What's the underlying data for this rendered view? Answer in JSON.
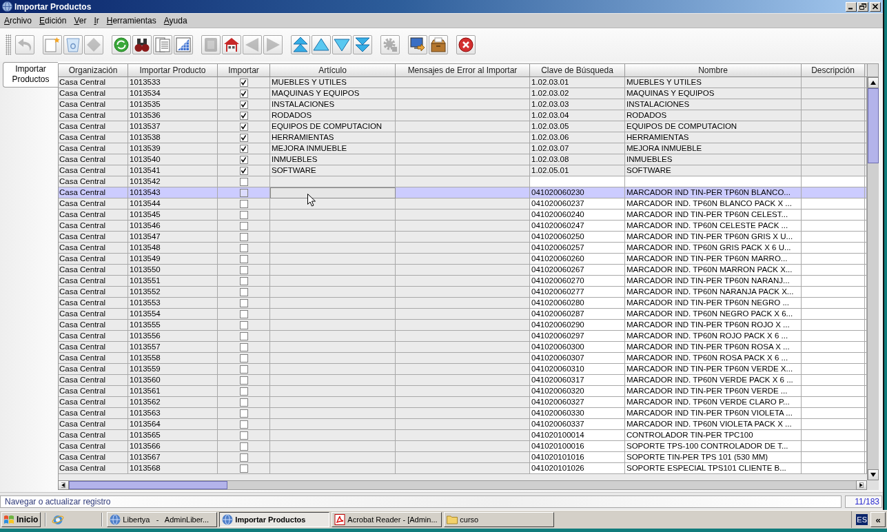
{
  "window": {
    "title": "Importar Productos"
  },
  "menu": [
    "Archivo",
    "Edición",
    "Ver",
    "Ir",
    "Herramientas",
    "Ayuda"
  ],
  "toolbar": {
    "groups": [
      [
        {
          "kind": "undo",
          "disabled": true
        }
      ],
      [
        {
          "kind": "new",
          "disabled": false
        },
        {
          "kind": "delete",
          "disabled": false
        },
        {
          "kind": "save",
          "disabled": true
        }
      ],
      [
        {
          "kind": "refresh",
          "disabled": false
        },
        {
          "kind": "find",
          "disabled": false
        },
        {
          "kind": "history",
          "disabled": false
        },
        {
          "kind": "grid",
          "disabled": false
        }
      ],
      [
        {
          "kind": "attachment",
          "disabled": true
        },
        {
          "kind": "home",
          "disabled": false
        },
        {
          "kind": "previous",
          "disabled": true
        },
        {
          "kind": "next",
          "disabled": true
        }
      ],
      [
        {
          "kind": "first",
          "disabled": false
        },
        {
          "kind": "up",
          "disabled": false
        },
        {
          "kind": "down",
          "disabled": false
        },
        {
          "kind": "last",
          "disabled": false
        }
      ],
      [
        {
          "kind": "process",
          "disabled": true
        }
      ],
      [
        {
          "kind": "export",
          "disabled": false
        },
        {
          "kind": "archive",
          "disabled": false
        }
      ],
      [
        {
          "kind": "close",
          "disabled": false
        }
      ]
    ]
  },
  "tabs": [
    {
      "label": "Importar Productos",
      "selected": true
    }
  ],
  "table": {
    "columns": [
      "Organización",
      "Importar Producto",
      "Importar",
      "Artículo",
      "Mensajes de Error al Importar",
      "Clave de Búsqueda",
      "Nombre",
      "Descripción"
    ],
    "rows": [
      {
        "organization": "Casa Central",
        "import_product": "1013533",
        "import": true,
        "article": "MUEBLES Y UTILES",
        "search_key": "1.02.03.01",
        "name": "MUEBLES Y UTILES",
        "selected": false,
        "article_focused": false
      },
      {
        "organization": "Casa Central",
        "import_product": "1013534",
        "import": true,
        "article": "MAQUINAS Y EQUIPOS",
        "search_key": "1.02.03.02",
        "name": "MAQUINAS Y EQUIPOS",
        "selected": false,
        "article_focused": false
      },
      {
        "organization": "Casa Central",
        "import_product": "1013535",
        "import": true,
        "article": "INSTALACIONES",
        "search_key": "1.02.03.03",
        "name": "INSTALACIONES",
        "selected": false,
        "article_focused": false
      },
      {
        "organization": "Casa Central",
        "import_product": "1013536",
        "import": true,
        "article": "RODADOS",
        "search_key": "1.02.03.04",
        "name": "RODADOS",
        "selected": false,
        "article_focused": false
      },
      {
        "organization": "Casa Central",
        "import_product": "1013537",
        "import": true,
        "article": "EQUIPOS DE COMPUTACION",
        "search_key": "1.02.03.05",
        "name": "EQUIPOS DE COMPUTACION",
        "selected": false,
        "article_focused": false
      },
      {
        "organization": "Casa Central",
        "import_product": "1013538",
        "import": true,
        "article": "HERRAMIENTAS",
        "search_key": "1.02.03.06",
        "name": "HERRAMIENTAS",
        "selected": false,
        "article_focused": false
      },
      {
        "organization": "Casa Central",
        "import_product": "1013539",
        "import": true,
        "article": "MEJORA INMUEBLE",
        "search_key": "1.02.03.07",
        "name": "MEJORA INMUEBLE",
        "selected": false,
        "article_focused": false
      },
      {
        "organization": "Casa Central",
        "import_product": "1013540",
        "import": true,
        "article": "INMUEBLES",
        "search_key": "1.02.03.08",
        "name": "INMUEBLES",
        "selected": false,
        "article_focused": false
      },
      {
        "organization": "Casa Central",
        "import_product": "1013541",
        "import": true,
        "article": "SOFTWARE",
        "search_key": "1.02.05.01",
        "name": "SOFTWARE",
        "selected": false,
        "article_focused": false
      },
      {
        "organization": "Casa Central",
        "import_product": "1013542",
        "import": false,
        "selected": false,
        "article_focused": false
      },
      {
        "organization": "Casa Central",
        "import_product": "1013543",
        "import": false,
        "search_key": "041020060230",
        "name": "MARCADOR IND TIN-PER TP60N BLANCO...",
        "selected": true,
        "article_focused": true
      },
      {
        "organization": "Casa Central",
        "import_product": "1013544",
        "import": false,
        "search_key": "041020060237",
        "name": "MARCADOR IND. TP60N BLANCO PACK X ...",
        "selected": false,
        "article_focused": false
      },
      {
        "organization": "Casa Central",
        "import_product": "1013545",
        "import": false,
        "search_key": "041020060240",
        "name": "MARCADOR IND TIN-PER TP60N CELEST...",
        "selected": false,
        "article_focused": false
      },
      {
        "organization": "Casa Central",
        "import_product": "1013546",
        "import": false,
        "search_key": "041020060247",
        "name": "MARCADOR IND. TP60N CELESTE PACK ...",
        "selected": false,
        "article_focused": false
      },
      {
        "organization": "Casa Central",
        "import_product": "1013547",
        "import": false,
        "search_key": "041020060250",
        "name": "MARCADOR IND TIN-PER TP60N GRIS X U...",
        "selected": false,
        "article_focused": false
      },
      {
        "organization": "Casa Central",
        "import_product": "1013548",
        "import": false,
        "search_key": "041020060257",
        "name": "MARCADOR IND. TP60N GRIS PACK X 6 U...",
        "selected": false,
        "article_focused": false
      },
      {
        "organization": "Casa Central",
        "import_product": "1013549",
        "import": false,
        "search_key": "041020060260",
        "name": "MARCADOR IND TIN-PER TP60N MARRO...",
        "selected": false,
        "article_focused": false
      },
      {
        "organization": "Casa Central",
        "import_product": "1013550",
        "import": false,
        "search_key": "041020060267",
        "name": "MARCADOR IND. TP60N MARRON PACK X...",
        "selected": false,
        "article_focused": false
      },
      {
        "organization": "Casa Central",
        "import_product": "1013551",
        "import": false,
        "search_key": "041020060270",
        "name": "MARCADOR IND TIN-PER TP60N NARANJ...",
        "selected": false,
        "article_focused": false
      },
      {
        "organization": "Casa Central",
        "import_product": "1013552",
        "import": false,
        "search_key": "041020060277",
        "name": "MARCADOR IND. TP60N NARANJA PACK X...",
        "selected": false,
        "article_focused": false
      },
      {
        "organization": "Casa Central",
        "import_product": "1013553",
        "import": false,
        "search_key": "041020060280",
        "name": "MARCADOR IND TIN-PER TP60N NEGRO ...",
        "selected": false,
        "article_focused": false
      },
      {
        "organization": "Casa Central",
        "import_product": "1013554",
        "import": false,
        "search_key": "041020060287",
        "name": "MARCADOR IND. TP60N NEGRO PACK X 6...",
        "selected": false,
        "article_focused": false
      },
      {
        "organization": "Casa Central",
        "import_product": "1013555",
        "import": false,
        "search_key": "041020060290",
        "name": "MARCADOR IND TIN-PER TP60N ROJO X ...",
        "selected": false,
        "article_focused": false
      },
      {
        "organization": "Casa Central",
        "import_product": "1013556",
        "import": false,
        "search_key": "041020060297",
        "name": "MARCADOR IND. TP60N ROJO PACK X 6 ...",
        "selected": false,
        "article_focused": false
      },
      {
        "organization": "Casa Central",
        "import_product": "1013557",
        "import": false,
        "search_key": "041020060300",
        "name": "MARCADOR IND TIN-PER TP60N ROSA X ...",
        "selected": false,
        "article_focused": false
      },
      {
        "organization": "Casa Central",
        "import_product": "1013558",
        "import": false,
        "search_key": "041020060307",
        "name": "MARCADOR IND. TP60N ROSA PACK X 6 ...",
        "selected": false,
        "article_focused": false
      },
      {
        "organization": "Casa Central",
        "import_product": "1013559",
        "import": false,
        "search_key": "041020060310",
        "name": "MARCADOR IND TIN-PER TP60N VERDE X...",
        "selected": false,
        "article_focused": false
      },
      {
        "organization": "Casa Central",
        "import_product": "1013560",
        "import": false,
        "search_key": "041020060317",
        "name": "MARCADOR IND. TP60N VERDE PACK X 6 ...",
        "selected": false,
        "article_focused": false
      },
      {
        "organization": "Casa Central",
        "import_product": "1013561",
        "import": false,
        "search_key": "041020060320",
        "name": "MARCADOR IND TIN-PER TP60N VERDE ...",
        "selected": false,
        "article_focused": false
      },
      {
        "organization": "Casa Central",
        "import_product": "1013562",
        "import": false,
        "search_key": "041020060327",
        "name": "MARCADOR IND. TP60N VERDE CLARO P...",
        "selected": false,
        "article_focused": false
      },
      {
        "organization": "Casa Central",
        "import_product": "1013563",
        "import": false,
        "search_key": "041020060330",
        "name": "MARCADOR IND TIN-PER TP60N VIOLETA ...",
        "selected": false,
        "article_focused": false
      },
      {
        "organization": "Casa Central",
        "import_product": "1013564",
        "import": false,
        "search_key": "041020060337",
        "name": "MARCADOR IND. TP60N VIOLETA PACK X ...",
        "selected": false,
        "article_focused": false
      },
      {
        "organization": "Casa Central",
        "import_product": "1013565",
        "import": false,
        "search_key": "041020100014",
        "name": "CONTROLADOR TIN-PER TPC100",
        "selected": false,
        "article_focused": false
      },
      {
        "organization": "Casa Central",
        "import_product": "1013566",
        "import": false,
        "search_key": "041020100016",
        "name": "SOPORTE TPS-100 CONTROLADOR DE T...",
        "selected": false,
        "article_focused": false
      },
      {
        "organization": "Casa Central",
        "import_product": "1013567",
        "import": false,
        "search_key": "041020101016",
        "name": "SOPORTE TIN-PER TPS 101 (530 MM)",
        "selected": false,
        "article_focused": false
      },
      {
        "organization": "Casa Central",
        "import_product": "1013568",
        "import": false,
        "search_key": "041020101026",
        "name": "SOPORTE ESPECIAL TPS101 CLIENTE B...",
        "selected": false,
        "article_focused": false
      }
    ]
  },
  "status_bar": {
    "message": "Navegar o actualizar registro",
    "record": "11/183"
  },
  "taskbar": {
    "start": "Inicio",
    "tasks": [
      {
        "label": "Libertya   -   AdminLiber...",
        "kind": "app",
        "selected": false
      },
      {
        "label": "Importar Productos",
        "kind": "app",
        "selected": true
      },
      {
        "label": "Acrobat Reader - [Admin...",
        "kind": "pdf",
        "selected": false
      },
      {
        "label": "curso",
        "kind": "folder",
        "selected": false
      }
    ],
    "language": "ES",
    "tray_toggle": "«"
  }
}
